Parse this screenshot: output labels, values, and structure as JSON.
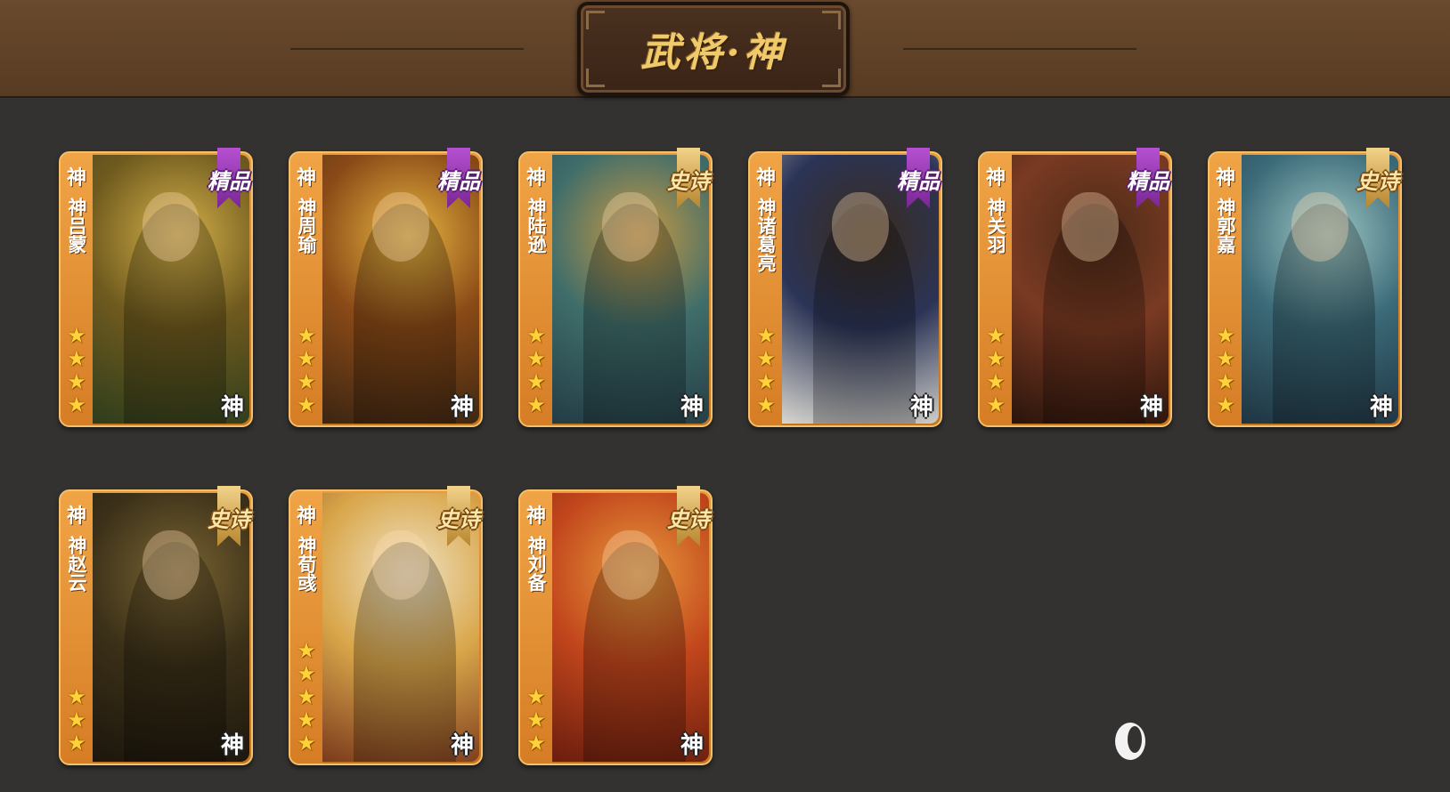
{
  "header": {
    "title": "武将·神"
  },
  "cards": [
    {
      "god": "神",
      "name": "神吕蒙",
      "badge": "精品",
      "badge_type": "jingpin",
      "stars": 4,
      "corner": "神",
      "art_colors": [
        "#d6b24a",
        "#6f5a1e",
        "#2e3d1c"
      ]
    },
    {
      "god": "神",
      "name": "神周瑜",
      "badge": "精品",
      "badge_type": "jingpin",
      "stars": 4,
      "corner": "神",
      "art_colors": [
        "#e8b640",
        "#8a4a17",
        "#3b2512"
      ]
    },
    {
      "god": "神",
      "name": "神陆逊",
      "badge": "史诗",
      "badge_type": "shishi",
      "stars": 4,
      "corner": "神",
      "art_colors": [
        "#c99a44",
        "#3f6d6a",
        "#233c45"
      ]
    },
    {
      "god": "神",
      "name": "神诸葛亮",
      "badge": "精品",
      "badge_type": "jingpin",
      "stars": 4,
      "corner": "神",
      "art_colors": [
        "#3a2b1b",
        "#2b3456",
        "#d8d6cf"
      ]
    },
    {
      "god": "神",
      "name": "神关羽",
      "badge": "精品",
      "badge_type": "jingpin",
      "stars": 4,
      "corner": "神",
      "art_colors": [
        "#4a2a18",
        "#7a3a22",
        "#2a140c"
      ]
    },
    {
      "god": "神",
      "name": "神郭嘉",
      "badge": "史诗",
      "badge_type": "shishi",
      "stars": 4,
      "corner": "神",
      "art_colors": [
        "#9fc7c4",
        "#3b6a78",
        "#1f3442"
      ]
    },
    {
      "god": "神",
      "name": "神赵云",
      "badge": "史诗",
      "badge_type": "shishi",
      "stars": 3,
      "corner": "神",
      "art_colors": [
        "#7a6433",
        "#3b3018",
        "#1c160c"
      ]
    },
    {
      "god": "神",
      "name": "神荀彧",
      "badge": "史诗",
      "badge_type": "shishi",
      "stars": 5,
      "corner": "神",
      "art_colors": [
        "#efe3c4",
        "#d9a64a",
        "#7a3a1c"
      ]
    },
    {
      "god": "神",
      "name": "神刘备",
      "badge": "史诗",
      "badge_type": "shishi",
      "stars": 3,
      "corner": "神",
      "art_colors": [
        "#e89a3c",
        "#c2461c",
        "#6a1d0e"
      ]
    }
  ]
}
